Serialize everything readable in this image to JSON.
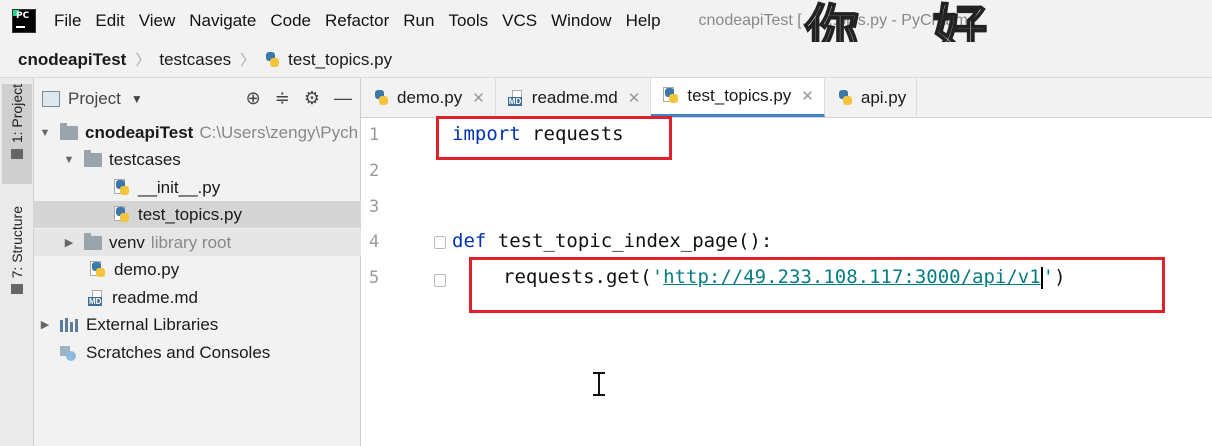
{
  "menubar": {
    "items": [
      "File",
      "Edit",
      "View",
      "Navigate",
      "Code",
      "Refactor",
      "Run",
      "Tools",
      "VCS",
      "Window",
      "Help"
    ],
    "window_title": "cnodeapiTest [...] ...pics.py - PyCharm",
    "overlay_text_left": "你",
    "overlay_text_right": "好"
  },
  "breadcrumb": [
    "cnodeapiTest",
    "testcases",
    "test_topics.py"
  ],
  "left_stripe": {
    "project_tab": "1: Project",
    "structure_tab": "7: Structure"
  },
  "project_panel": {
    "title": "Project",
    "tree": [
      {
        "label": "cnodeapiTest",
        "extra": "C:\\Users\\zengy\\Pych",
        "type": "folder",
        "expanded": true
      },
      {
        "label": "testcases",
        "type": "folder",
        "expanded": true
      },
      {
        "label": "__init__.py",
        "type": "py"
      },
      {
        "label": "test_topics.py",
        "type": "py",
        "selected": true
      },
      {
        "label": "venv",
        "extra": "library root",
        "type": "folder",
        "expanded": false
      },
      {
        "label": "demo.py",
        "type": "py"
      },
      {
        "label": "readme.md",
        "type": "md"
      },
      {
        "label": "External Libraries",
        "type": "libs",
        "expanded": false
      },
      {
        "label": "Scratches and Consoles",
        "type": "scratch"
      }
    ]
  },
  "editor": {
    "tabs": [
      {
        "label": "demo.py",
        "type": "py",
        "active": false
      },
      {
        "label": "readme.md",
        "type": "md",
        "active": false
      },
      {
        "label": "test_topics.py",
        "type": "py",
        "active": true
      },
      {
        "label": "api.py",
        "type": "py",
        "active": false
      }
    ],
    "line_numbers": [
      "1",
      "2",
      "3",
      "4",
      "5"
    ],
    "code": {
      "line1_kw": "import",
      "line1_rest": " requests",
      "line4_kw": "def",
      "line4_rest": " test_topic_index_page():",
      "line5_call": "requests.get(",
      "line5_quote_open": "'",
      "line5_url": "http://49.233.108.117:3000/api/v1",
      "line5_quote_close": "'",
      "line5_end": ")"
    },
    "accent_color": "#4083c9",
    "highlight_color": "#e0202a"
  }
}
